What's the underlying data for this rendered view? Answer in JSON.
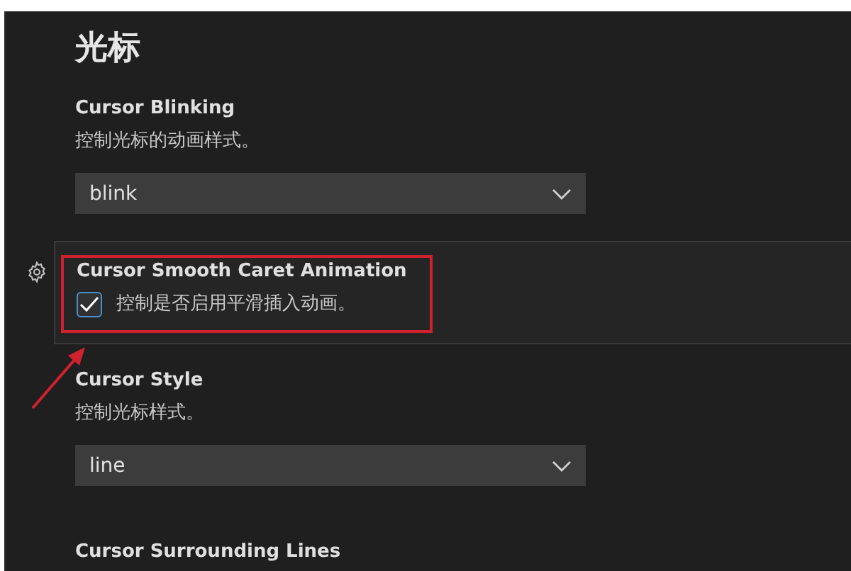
{
  "heading": "光标",
  "settings": [
    {
      "kind": "dropdown",
      "title": "Cursor Blinking",
      "description": "控制光标的动画样式。",
      "value": "blink",
      "focused": false,
      "highlighted": false
    },
    {
      "kind": "checkbox",
      "title": "Cursor Smooth Caret Animation",
      "description": "控制是否启用平滑插入动画。",
      "checked": true,
      "focused": true,
      "highlighted": true
    },
    {
      "kind": "dropdown",
      "title": "Cursor Style",
      "description": "控制光标样式。",
      "value": "line",
      "focused": false,
      "highlighted": false
    },
    {
      "kind": "heading_only",
      "title": "Cursor Surrounding Lines",
      "focused": false,
      "highlighted": false
    }
  ]
}
